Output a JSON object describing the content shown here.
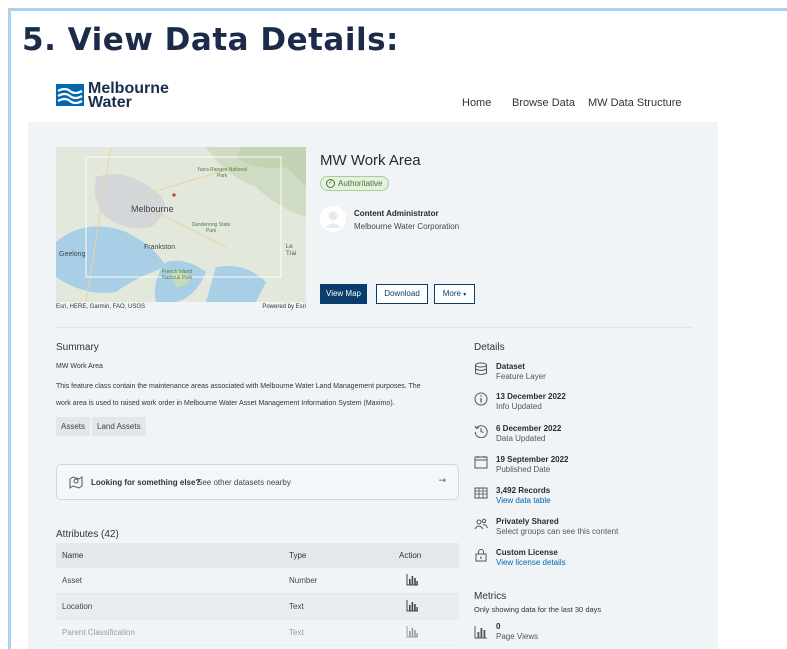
{
  "slide": {
    "title": "5. View Data Details:"
  },
  "brand": {
    "line1": "Melbourne",
    "line2": "Water",
    "color": "#0067b1"
  },
  "nav": {
    "items": [
      "Home",
      "Browse Data",
      "MW Data Structure"
    ]
  },
  "map": {
    "labels": [
      "Melbourne",
      "Frankston",
      "Geelong",
      "Yarra Ranges National Park",
      "French Island National Park",
      "Dandenong State Park",
      "Le Trai"
    ],
    "attribution_left": "Esri, HERE, Garmin, FAO, USGS",
    "attribution_right": "Powered by Esri"
  },
  "dataset": {
    "title": "MW Work Area",
    "badge": "Authoritative",
    "owner_name": "Content Administrator",
    "owner_org": "Melbourne Water Corporation"
  },
  "actions": {
    "view_map": "View Map",
    "download": "Download",
    "more": "More"
  },
  "summary": {
    "heading": "Summary",
    "subtitle": "MW Work Area",
    "line1": "This feature class contain the maintenance areas associated with Melbourne Water Land Management purposes. The",
    "line2": "work area is used to raised work order in Melbourne Water Asset Management Information System (Maximo).",
    "tags": [
      "Assets",
      "Land Assets"
    ]
  },
  "nearby": {
    "bold": "Looking for something else?",
    "rest": "See other datasets nearby",
    "arrow": "→"
  },
  "attributes": {
    "heading": "Attributes (42)",
    "columns": {
      "name": "Name",
      "type": "Type",
      "action": "Action"
    },
    "rows": [
      {
        "name": "Asset",
        "type": "Number"
      },
      {
        "name": "Location",
        "type": "Text"
      },
      {
        "name": "Parent Classification",
        "type": "Text"
      }
    ]
  },
  "details": {
    "heading": "Details",
    "items": [
      {
        "icon": "database-icon",
        "t1": "Dataset",
        "t2": "Feature Layer"
      },
      {
        "icon": "info-icon",
        "t1": "13 December 2022",
        "t2": "Info Updated"
      },
      {
        "icon": "history-icon",
        "t1": "6 December 2022",
        "t2": "Data Updated"
      },
      {
        "icon": "calendar-icon",
        "t1": "19 September 2022",
        "t2": "Published Date"
      },
      {
        "icon": "table-icon",
        "t1": "3,492 Records",
        "t2": "View data table"
      },
      {
        "icon": "users-icon",
        "t1": "Privately Shared",
        "t2": "Select groups can see this content"
      },
      {
        "icon": "license-icon",
        "t1": "Custom License",
        "t2": "View license details"
      }
    ]
  },
  "metrics": {
    "heading": "Metrics",
    "subtitle": "Only showing data for the last 30 days",
    "value": "0",
    "label": "Page Views"
  }
}
